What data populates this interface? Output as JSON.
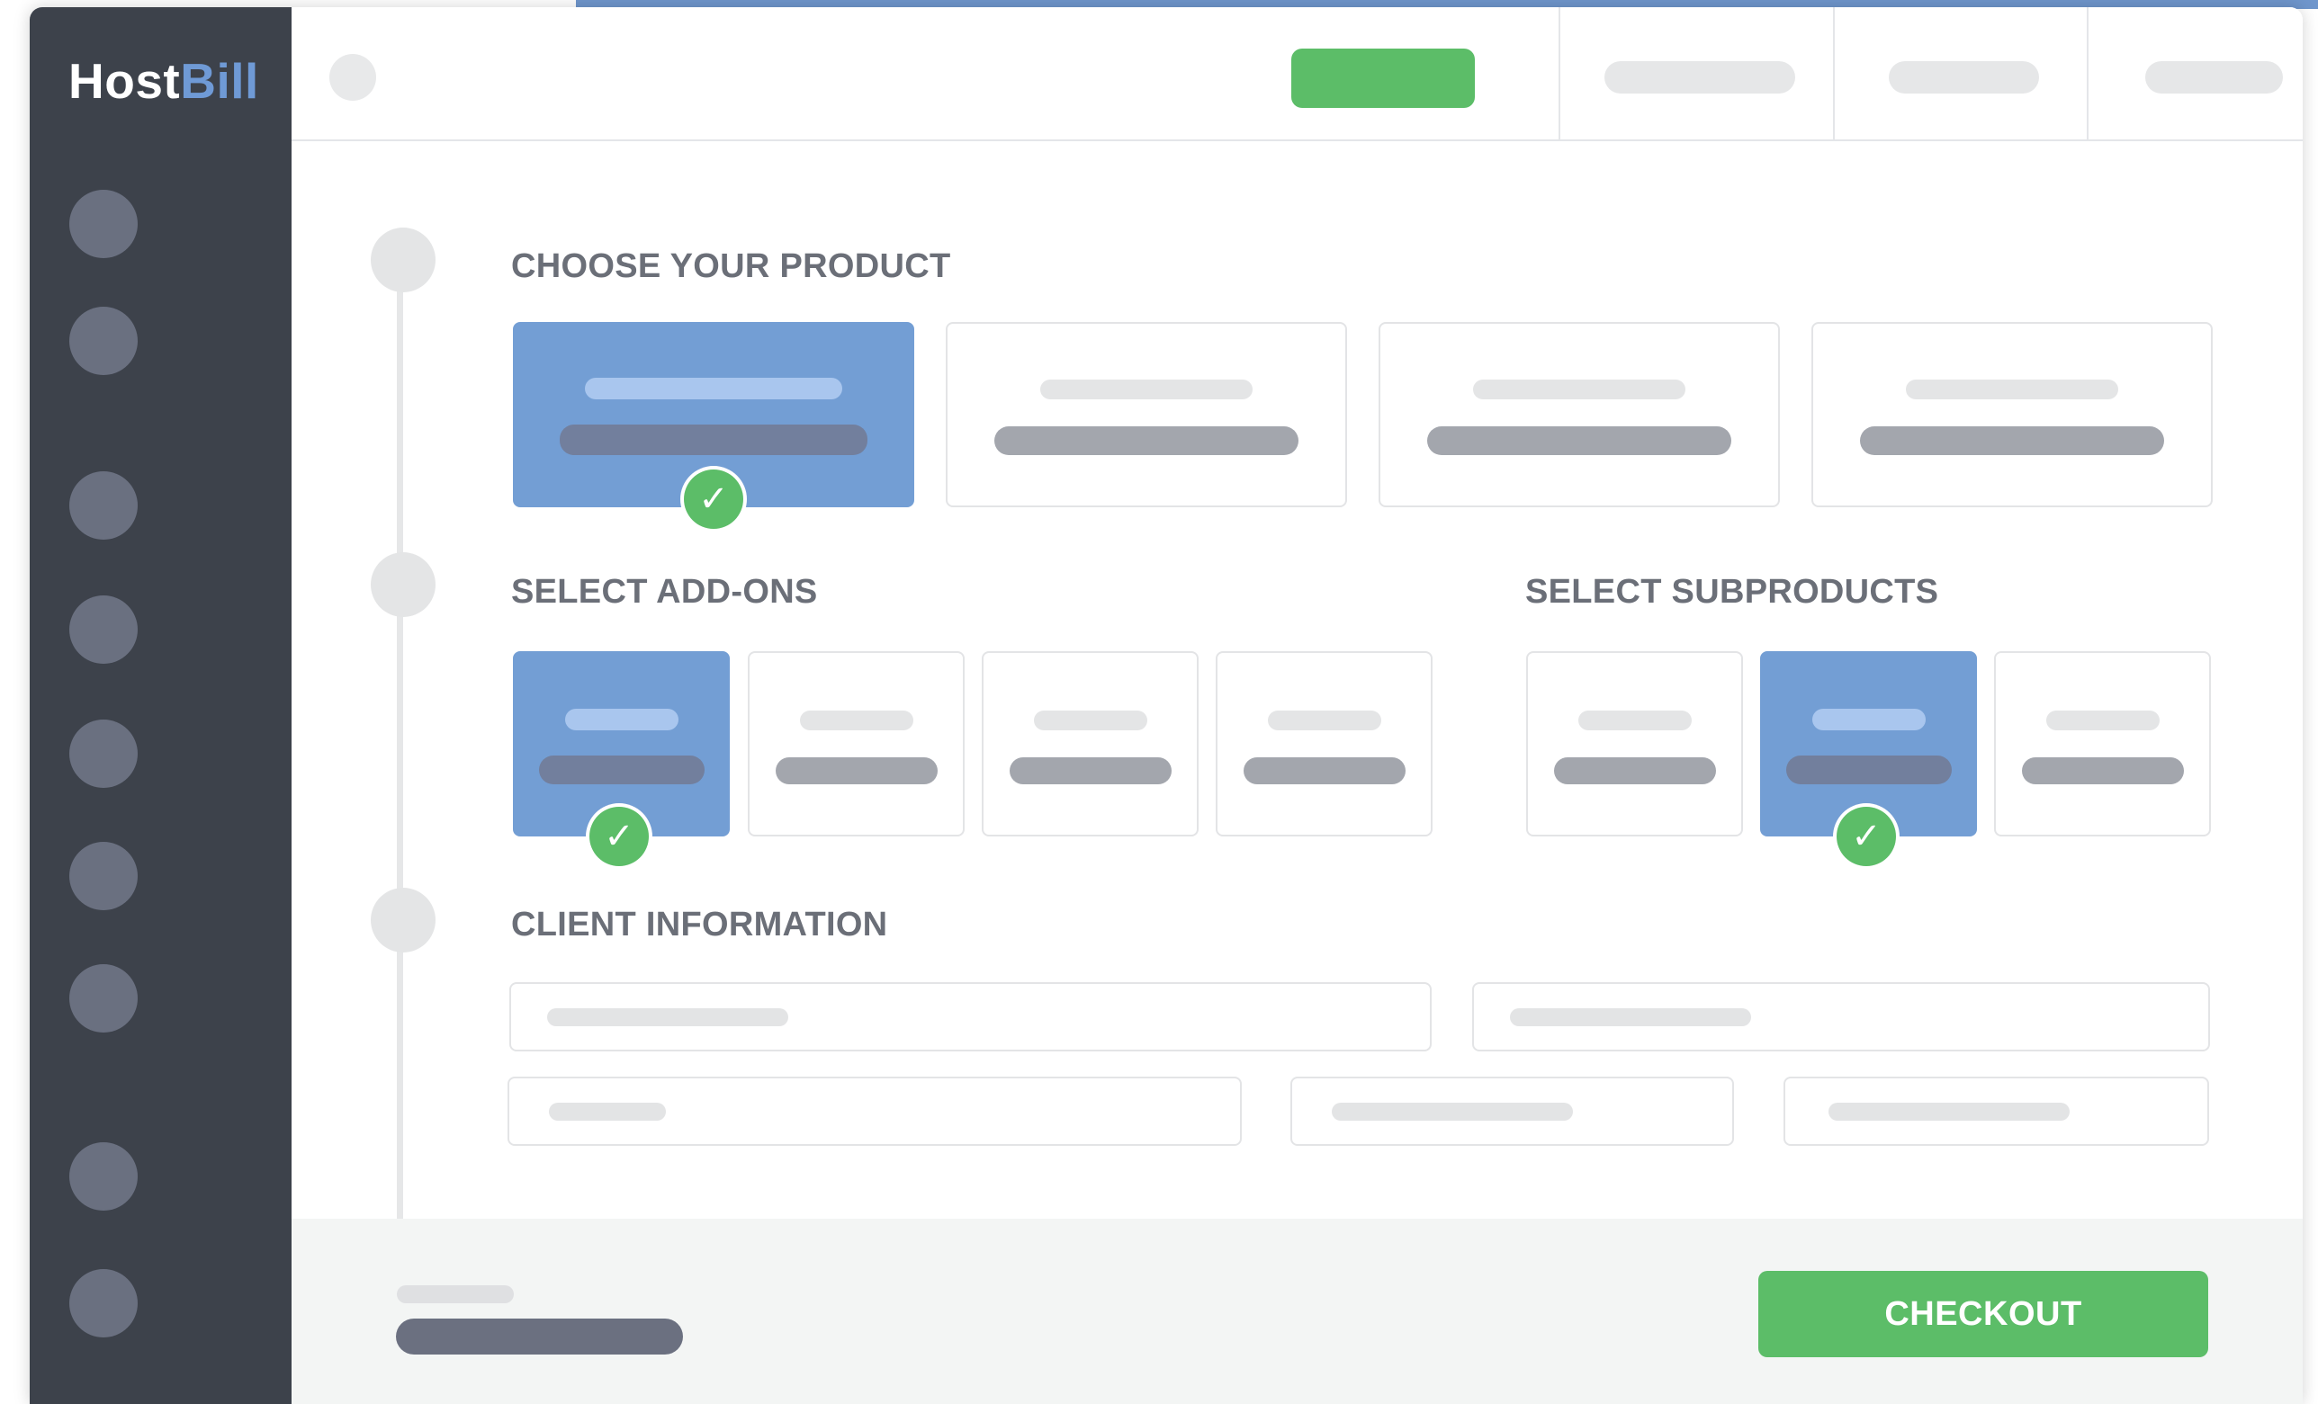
{
  "brand": {
    "part1": "Host",
    "part2": "Bill",
    "accent_color": "#6f9ad6"
  },
  "colors": {
    "sidebar": "#3d424b",
    "selected_card": "#739ed4",
    "green": "#5cbd68"
  },
  "icons": {
    "check": "✓"
  },
  "sections": {
    "product": {
      "title": "CHOOSE YOUR PRODUCT"
    },
    "addons": {
      "title": "SELECT ADD-ONS"
    },
    "subproducts": {
      "title": "SELECT SUBPRODUCTS"
    },
    "client": {
      "title": "CLIENT INFORMATION"
    }
  },
  "footer": {
    "checkout_label": "CHECKOUT"
  }
}
